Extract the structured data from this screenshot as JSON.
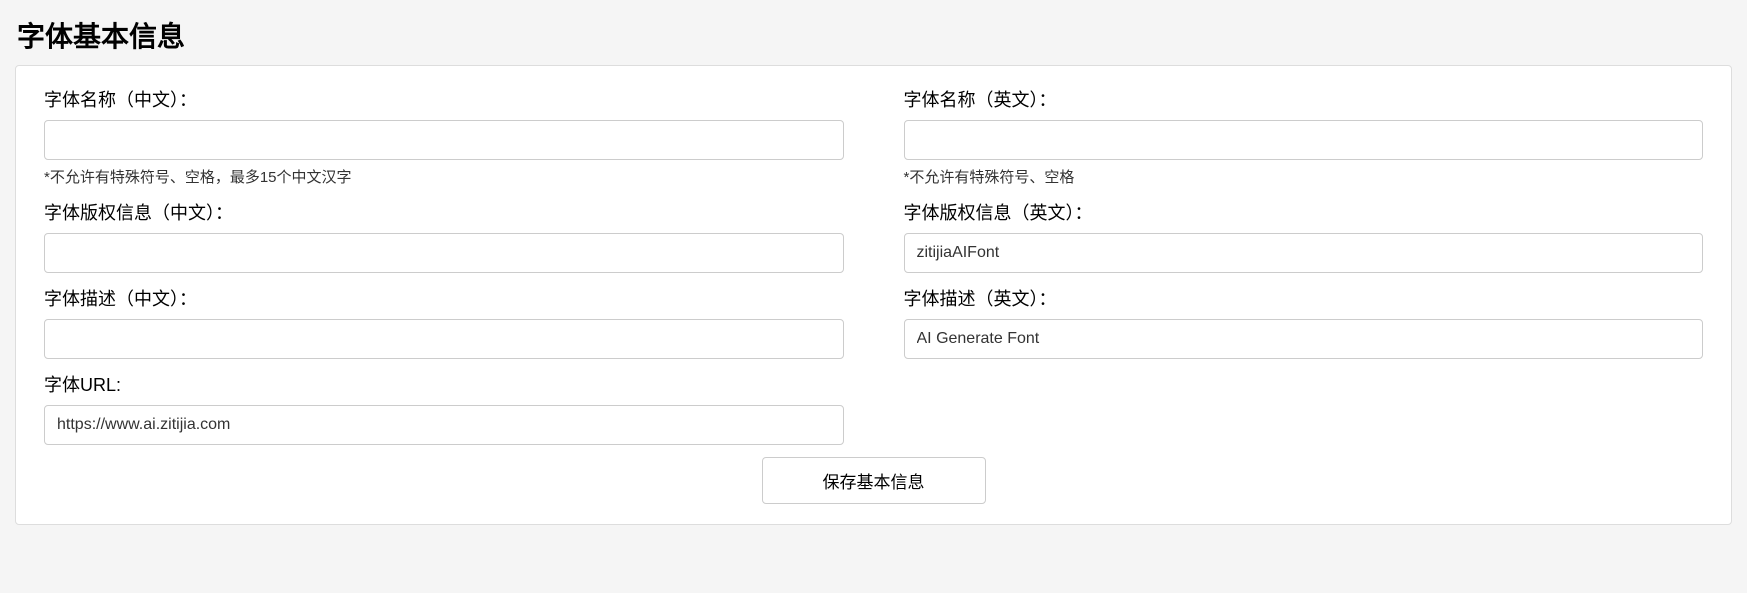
{
  "page": {
    "title": "字体基本信息"
  },
  "fields": {
    "name_cn": {
      "label": "字体名称（中文）：",
      "value": "",
      "hint": "*不允许有特殊符号、空格，最多15个中文汉字"
    },
    "name_en": {
      "label": "字体名称（英文）：",
      "value": "",
      "hint": "*不允许有特殊符号、空格"
    },
    "copyright_cn": {
      "label": "字体版权信息（中文）：",
      "value": ""
    },
    "copyright_en": {
      "label": "字体版权信息（英文）：",
      "value": "zitijiaAIFont"
    },
    "desc_cn": {
      "label": "字体描述（中文）：",
      "value": ""
    },
    "desc_en": {
      "label": "字体描述（英文）：",
      "value": "AI Generate Font"
    },
    "url": {
      "label": "字体URL:",
      "value": "https://www.ai.zitijia.com"
    }
  },
  "buttons": {
    "save": "保存基本信息"
  }
}
